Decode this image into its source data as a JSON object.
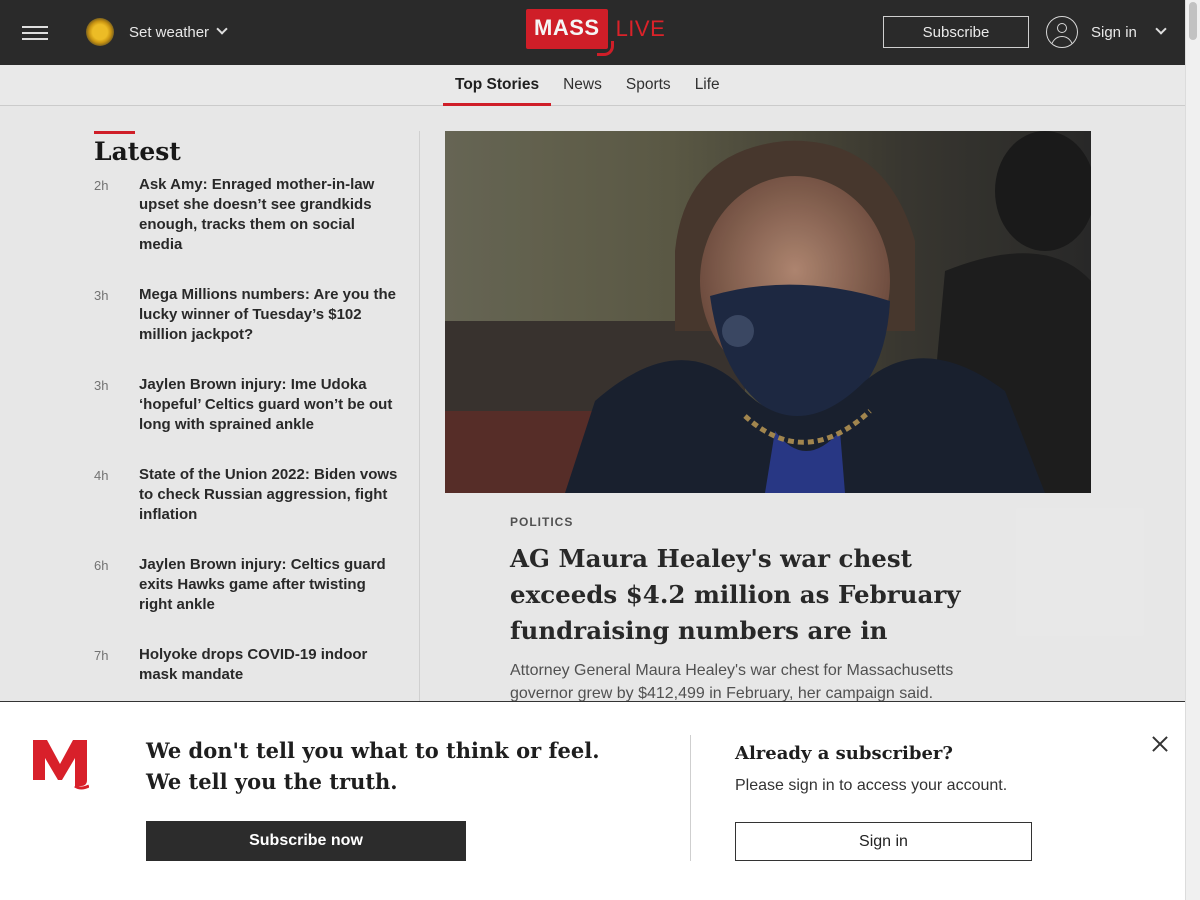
{
  "header": {
    "weather_label": "Set weather",
    "logo_part1": "MASS",
    "logo_part2": "LIVE",
    "subscribe_label": "Subscribe",
    "signin_label": "Sign in"
  },
  "nav": {
    "tabs": [
      {
        "label": "Top Stories",
        "active": true
      },
      {
        "label": "News",
        "active": false
      },
      {
        "label": "Sports",
        "active": false
      },
      {
        "label": "Life",
        "active": false
      }
    ]
  },
  "latest": {
    "title": "Latest",
    "items": [
      {
        "time": "2h",
        "headline": "Ask Amy: Enraged mother-in-law upset she doesn’t see grandkids enough, tracks them on social media"
      },
      {
        "time": "3h",
        "headline": "Mega Millions numbers: Are you the lucky winner of Tuesday’s $102 million jackpot?"
      },
      {
        "time": "3h",
        "headline": "Jaylen Brown injury: Ime Udoka ‘hopeful’ Celtics guard won’t be out long with sprained ankle"
      },
      {
        "time": "4h",
        "headline": "State of the Union 2022: Biden vows to check Russian aggression, fight inflation"
      },
      {
        "time": "6h",
        "headline": "Jaylen Brown injury: Celtics guard exits Hawks game after twisting right ankle"
      },
      {
        "time": "7h",
        "headline": "Holyoke drops COVID-19 indoor mask mandate"
      }
    ]
  },
  "story": {
    "kicker": "POLITICS",
    "headline": "AG Maura Healey's war chest exceeds $4.2 million as February fundraising numbers are in",
    "summary": "Attorney General Maura Healey's war chest for Massachusetts governor grew by $412,499 in February, her campaign said."
  },
  "modal": {
    "tagline_line1": "We don't tell you what to think or feel.",
    "tagline_line2": "We tell you the truth.",
    "subscribe_now_label": "Subscribe now",
    "already_title": "Already a subscriber?",
    "please_text": "Please sign in to access your account.",
    "signin_label": "Sign in"
  },
  "colors": {
    "brand_red": "#d8202a",
    "header_bg": "#2c2c2c"
  }
}
